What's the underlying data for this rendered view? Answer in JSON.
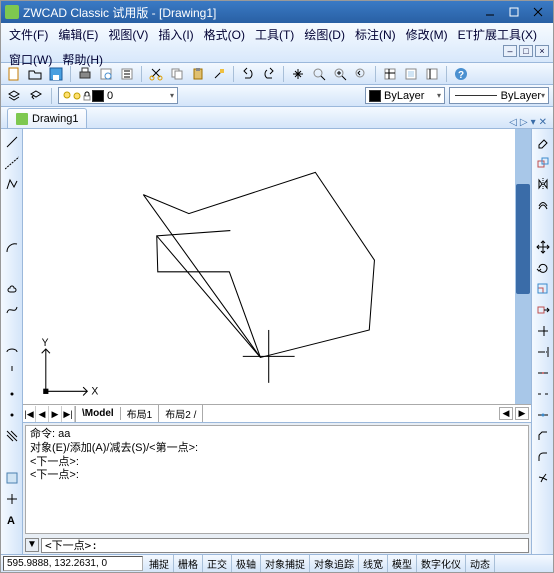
{
  "title": "ZWCAD Classic 试用版 - [Drawing1]",
  "menu": [
    "文件(F)",
    "编辑(E)",
    "视图(V)",
    "插入(I)",
    "格式(O)",
    "工具(T)",
    "绘图(D)",
    "标注(N)",
    "修改(M)",
    "ET扩展工具(X)",
    "窗口(W)",
    "帮助(H)"
  ],
  "tab": {
    "name": "Drawing1"
  },
  "tab_nav": {
    "prev": "◁",
    "next": "▷",
    "menu": "▾",
    "close": "✕"
  },
  "doc_btns": {
    "min": "–",
    "max": "□",
    "close": "×"
  },
  "layerbox": {
    "current": "0"
  },
  "colorbox": {
    "current": "ByLayer"
  },
  "linetype": {
    "sample": "———",
    "current": "ByLayer"
  },
  "layout_tabs": {
    "items": [
      "Model",
      "布局1",
      "布局2"
    ],
    "active": 0,
    "nav": [
      "|◀",
      "◀",
      "▶",
      "▶|"
    ],
    "hscroll": [
      "◀",
      "▶"
    ]
  },
  "cmd_history": [
    "命令: aa",
    "对象(E)/添加(A)/减去(S)/<第一点>:",
    "<下一点>:",
    "<下一点>:"
  ],
  "cmd_input": {
    "arrow": "▼",
    "value": "<下一点>:"
  },
  "status": {
    "coords": "595.9888, 132.2631, 0",
    "buttons": [
      "捕捉",
      "栅格",
      "正交",
      "极轴",
      "对象捕捉",
      "对象追踪",
      "线宽",
      "模型",
      "数字化仪",
      "动态"
    ]
  },
  "axis_labels": {
    "x": "X",
    "y": "Y"
  }
}
